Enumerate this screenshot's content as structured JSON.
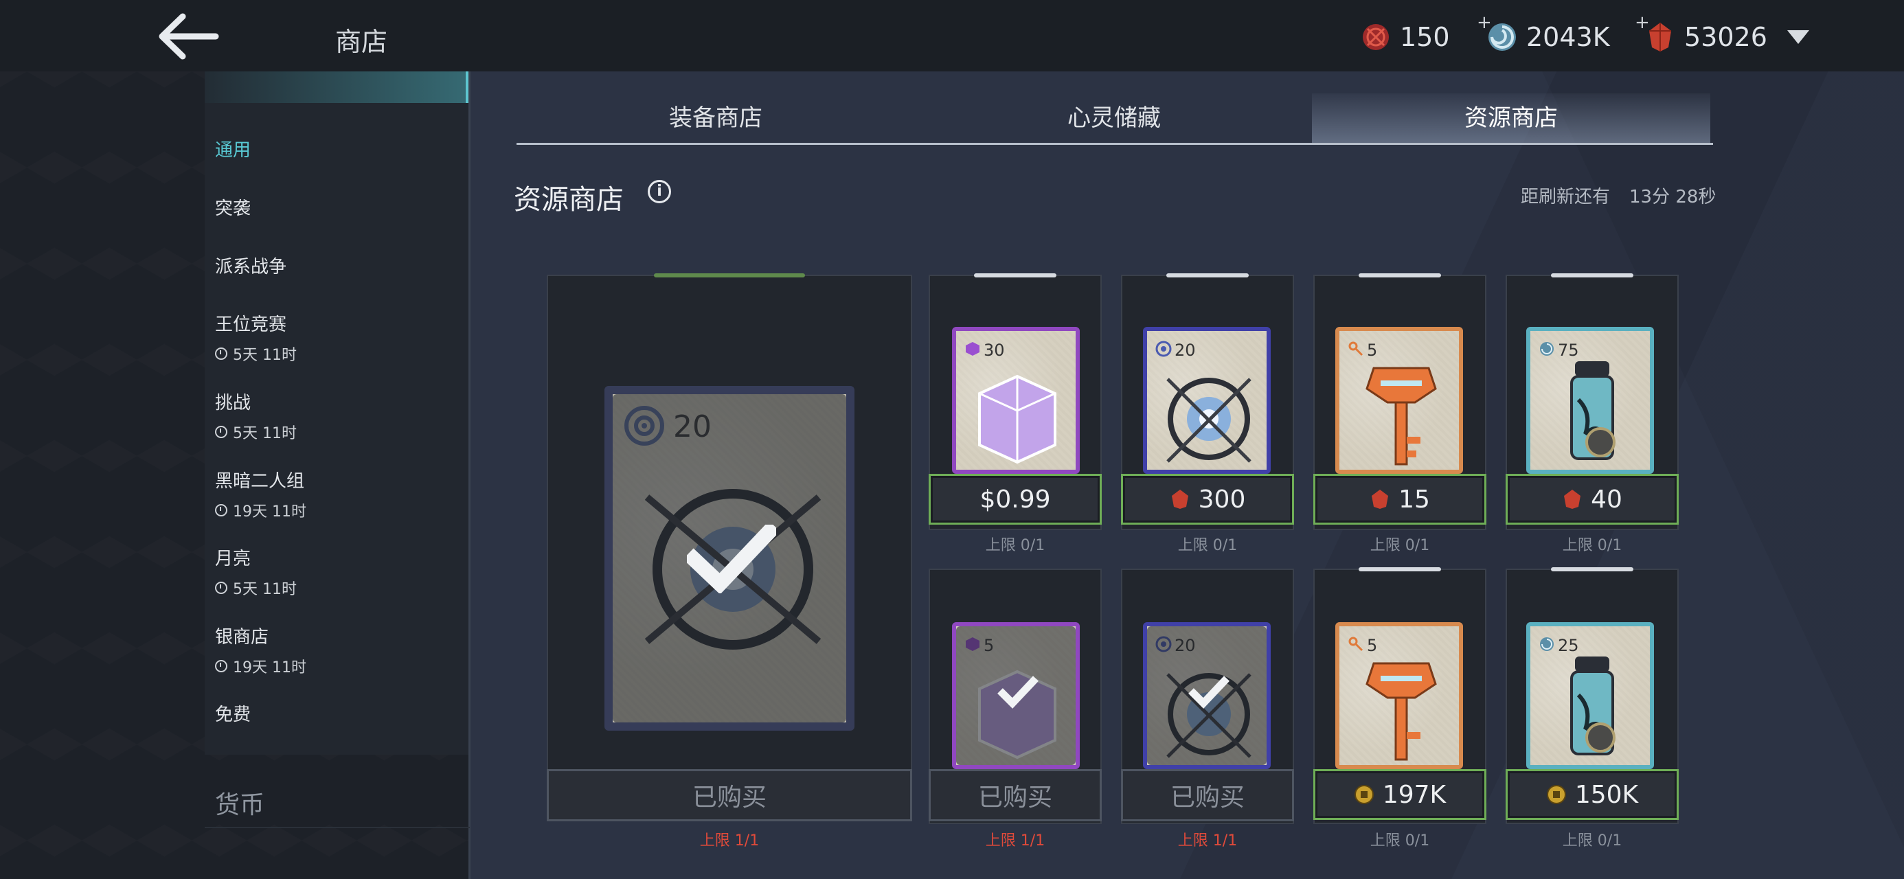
{
  "header": {
    "title": "商店",
    "currencies": [
      {
        "icon": "red-orb-icon",
        "value": "150"
      },
      {
        "icon": "blue-swirl-icon",
        "value": "2043K"
      },
      {
        "icon": "red-gem-icon",
        "value": "53026"
      }
    ]
  },
  "sidebar": {
    "items": [
      {
        "label": "通用",
        "timer": ""
      },
      {
        "label": "突袭",
        "timer": ""
      },
      {
        "label": "派系战争",
        "timer": ""
      },
      {
        "label": "王位竞赛",
        "timer": "5天 11时"
      },
      {
        "label": "挑战",
        "timer": "5天 11时"
      },
      {
        "label": "黑暗二人组",
        "timer": "19天 11时"
      },
      {
        "label": "月亮",
        "timer": "5天 11时"
      },
      {
        "label": "银商店",
        "timer": "19天 11时"
      },
      {
        "label": "免费",
        "timer": ""
      }
    ],
    "currency_label": "货币"
  },
  "tabs": [
    {
      "label": "装备商店"
    },
    {
      "label": "心灵储藏"
    },
    {
      "label": "资源商店"
    }
  ],
  "section": {
    "title": "资源商店",
    "refresh_label": "距刷新还有",
    "refresh_time": "13分 28秒"
  },
  "colors": {
    "accent": "#59c9d4",
    "price_border": "#6fae57",
    "limit_red": "#e04a3a"
  },
  "featured": {
    "qty": "20",
    "item": "compass-orb",
    "status": "已购买",
    "limit": "上限 1/1"
  },
  "cards_row1": [
    {
      "qty": "30",
      "item": "purple-cube",
      "price": "$0.99",
      "price_icon": "",
      "limit": "上限 0/1"
    },
    {
      "qty": "20",
      "item": "compass-orb",
      "price": "300",
      "price_icon": "red-gem-icon",
      "limit": "上限 0/1"
    },
    {
      "qty": "5",
      "item": "orange-key",
      "price": "15",
      "price_icon": "red-gem-icon",
      "limit": "上限 0/1"
    },
    {
      "qty": "75",
      "item": "potion-vial",
      "price": "40",
      "price_icon": "red-gem-icon",
      "limit": "上限 0/1"
    }
  ],
  "cards_row2": [
    {
      "qty": "5",
      "item": "purple-cube",
      "status": "已购买",
      "limit": "上限 1/1"
    },
    {
      "qty": "20",
      "item": "compass-orb",
      "status": "已购买",
      "limit": "上限 1/1"
    },
    {
      "qty": "5",
      "item": "orange-key",
      "price": "197K",
      "price_icon": "gold-coin-icon",
      "limit": "上限 0/1"
    },
    {
      "qty": "25",
      "item": "potion-vial",
      "price": "150K",
      "price_icon": "gold-coin-icon",
      "limit": "上限 0/1"
    }
  ]
}
